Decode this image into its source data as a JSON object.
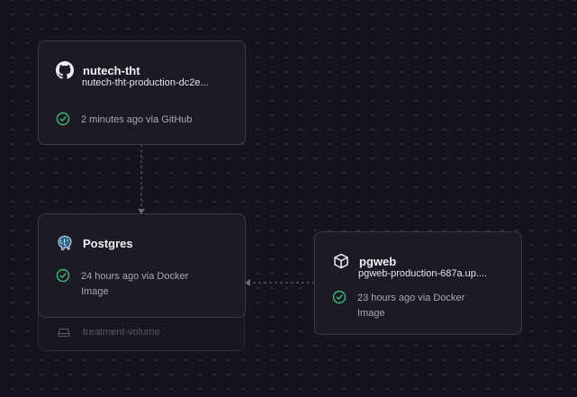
{
  "services": {
    "nutech": {
      "title": "nutech-tht",
      "url": "nutech-tht-production-dc2e...",
      "status": "2 minutes ago via GitHub",
      "icon": "github-icon"
    },
    "postgres": {
      "title": "Postgres",
      "status": "24 hours ago via Docker Image",
      "icon": "postgres-elephant-icon",
      "volume": "treatment-volume"
    },
    "pgweb": {
      "title": "pgweb",
      "url": "pgweb-production-687a.up....",
      "status": "23 hours ago via Docker Image",
      "icon": "box-icon"
    }
  },
  "colors": {
    "background": "#15141c",
    "card": "#1c1b24",
    "card_border": "#3a3946",
    "success": "#3fb97e",
    "connector": "#5a5966"
  }
}
